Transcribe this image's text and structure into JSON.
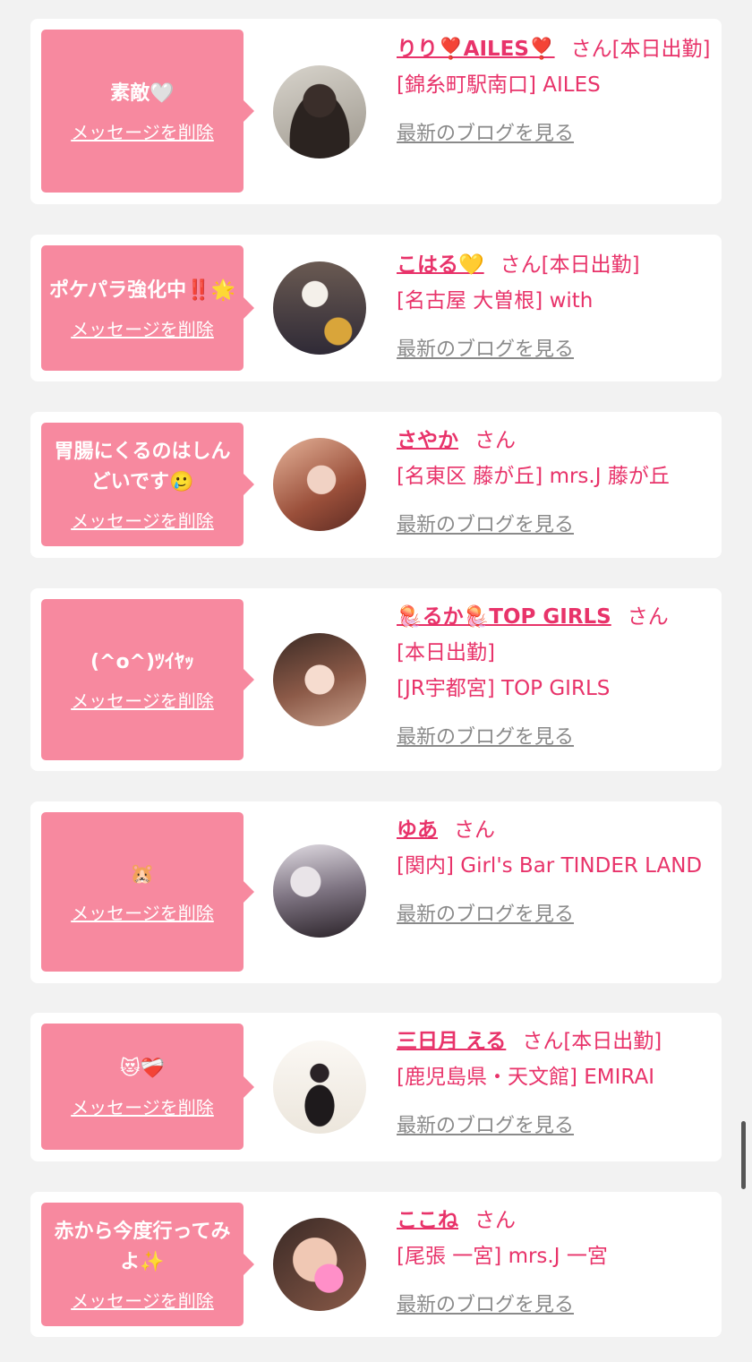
{
  "delete_label": "メッセージを削除",
  "blog_label": "最新のブログを見る",
  "san": "さん",
  "cards": [
    {
      "message": "素敵🤍",
      "name": "りり❣️AILES❣️",
      "status": "[本日出勤]",
      "shop": "[錦糸町駅南口] AILES"
    },
    {
      "message": "ポケパラ強化中‼️🌟",
      "name": "こはる💛",
      "status": "[本日出勤]",
      "shop": "[名古屋 大曽根] with"
    },
    {
      "message": "胃腸にくるのはしんどいです🥲",
      "name": "さやか",
      "status": "",
      "shop": "[名東区 藤が丘] mrs.J 藤が丘"
    },
    {
      "message": "(^o^)ﾂｲﾔｯ",
      "name": "🪼るか🪼TOP GIRLS",
      "status": "[本日出勤]",
      "shop": "[JR宇都宮] TOP GIRLS"
    },
    {
      "message": "🐹",
      "name": "ゆあ",
      "status": "",
      "shop": "[関内] Girl's Bar TINDER LAND"
    },
    {
      "message": "😻❤️‍🩹",
      "name": "三日月 える",
      "status": "[本日出勤]",
      "shop": "[鹿児島県・天文館] EMIRAI"
    },
    {
      "message": "赤から今度行ってみよ✨",
      "name": "ここね",
      "status": "",
      "shop": "[尾張 一宮] mrs.J 一宮"
    }
  ],
  "colors": {
    "accent": "#e8336a",
    "bubble": "#f7899f",
    "background": "#f2f2f2"
  }
}
